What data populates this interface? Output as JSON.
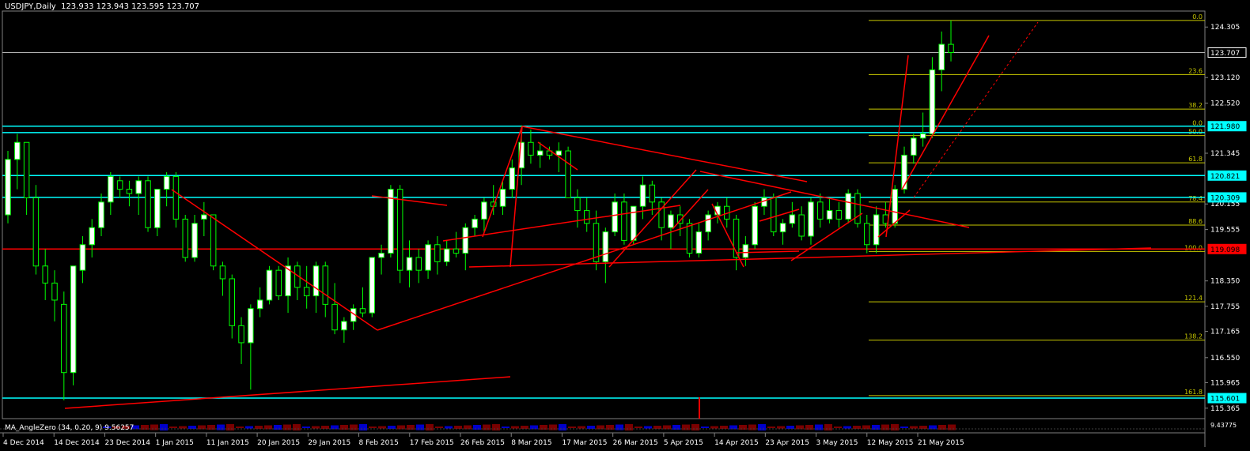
{
  "header": {
    "symbol": "USDJPY,Daily",
    "ohlc": "123.933 123.943 123.595 123.707"
  },
  "subwindow": {
    "label": "MA_AngleZero (34, 0.20, 9) 9.56257",
    "value_label": "9.43775"
  },
  "colors": {
    "background": "#000000",
    "bull": "#ffffff",
    "bear": "#000000",
    "wick": "#00ff00",
    "support": "#00ffff",
    "trend": "#ff0000",
    "fib": "#c8c800",
    "axis_text": "#ffffff"
  },
  "chart_data": {
    "type": "candlestick",
    "x_labels": [
      "4 Dec 2014",
      "14 Dec 2014",
      "23 Dec 2014",
      "1 Jan 2015",
      "11 Jan 2015",
      "20 Jan 2015",
      "29 Jan 2015",
      "8 Feb 2015",
      "17 Feb 2015",
      "26 Feb 2015",
      "8 Mar 2015",
      "17 Mar 2015",
      "26 Mar 2015",
      "5 Apr 2015",
      "14 Apr 2015",
      "23 Apr 2015",
      "3 May 2015",
      "12 May 2015",
      "21 May 2015"
    ],
    "y_ticks": [
      "124.305",
      "123.120",
      "122.520",
      "121.345",
      "120.155",
      "119.555",
      "118.350",
      "117.755",
      "117.165",
      "116.550",
      "115.965",
      "115.365"
    ],
    "y_tick_values": [
      124.305,
      123.12,
      122.52,
      121.345,
      120.155,
      119.555,
      118.35,
      117.755,
      117.165,
      116.55,
      115.965,
      115.365
    ],
    "ylim": [
      115.12,
      124.68
    ],
    "price_labels": [
      {
        "text": "123.707",
        "value": 123.707,
        "style": "last"
      },
      {
        "text": "121.980",
        "value": 121.98,
        "style": "cyan"
      },
      {
        "text": "120.821",
        "value": 120.821,
        "style": "cyan"
      },
      {
        "text": "120.309",
        "value": 120.309,
        "style": "cyan"
      },
      {
        "text": "119.098",
        "value": 119.098,
        "style": "red"
      },
      {
        "text": "115.601",
        "value": 115.601,
        "style": "cyan"
      }
    ],
    "support_levels": [
      121.98,
      121.83,
      120.821,
      120.309,
      115.601
    ],
    "resistance_level": 119.098,
    "last_price": 123.707,
    "fib_levels": [
      {
        "label": "0.0",
        "value": 124.46
      },
      {
        "label": "23.6",
        "value": 123.19
      },
      {
        "label": "38.2",
        "value": 122.38
      },
      {
        "label": "50.0",
        "value": 121.76
      },
      {
        "label": "61.8",
        "value": 121.12
      },
      {
        "label": "78.4",
        "value": 120.2
      },
      {
        "label": "88.6",
        "value": 119.66
      },
      {
        "label": "100.0",
        "value": 119.04
      },
      {
        "label": "121.4",
        "value": 117.86
      },
      {
        "label": "138.2",
        "value": 116.96
      },
      {
        "label": "161.8",
        "value": 115.66
      }
    ],
    "fib_top_label": {
      "label": "0.0",
      "value": 121.98
    },
    "candles": [
      [
        119.9,
        121.4,
        119.7,
        121.2
      ],
      [
        121.2,
        121.8,
        120.5,
        121.6
      ],
      [
        121.6,
        121.6,
        119.9,
        120.3
      ],
      [
        120.3,
        120.6,
        118.5,
        118.7
      ],
      [
        118.7,
        119.1,
        117.9,
        118.3
      ],
      [
        118.3,
        118.6,
        117.4,
        117.9
      ],
      [
        117.8,
        118.1,
        115.55,
        116.2
      ],
      [
        116.2,
        118.7,
        115.9,
        118.7
      ],
      [
        118.6,
        119.4,
        118.3,
        119.2
      ],
      [
        119.2,
        119.8,
        118.9,
        119.6
      ],
      [
        119.6,
        120.4,
        119.4,
        120.2
      ],
      [
        120.2,
        120.9,
        119.9,
        120.8
      ],
      [
        120.7,
        120.8,
        120.3,
        120.5
      ],
      [
        120.5,
        120.7,
        120.1,
        120.4
      ],
      [
        120.4,
        120.8,
        119.9,
        120.7
      ],
      [
        120.7,
        120.8,
        119.5,
        119.6
      ],
      [
        119.6,
        120.5,
        119.4,
        120.5
      ],
      [
        120.5,
        120.9,
        120.1,
        120.8
      ],
      [
        120.8,
        120.9,
        119.6,
        119.8
      ],
      [
        119.8,
        119.9,
        118.8,
        118.9
      ],
      [
        118.9,
        119.9,
        118.8,
        119.7
      ],
      [
        119.8,
        120.2,
        119.4,
        119.9
      ],
      [
        119.9,
        119.9,
        118.6,
        118.7
      ],
      [
        118.7,
        118.8,
        118.0,
        118.4
      ],
      [
        118.4,
        118.5,
        117.0,
        117.3
      ],
      [
        117.3,
        117.5,
        116.4,
        116.9
      ],
      [
        116.9,
        117.8,
        115.8,
        117.7
      ],
      [
        117.7,
        118.2,
        117.5,
        117.9
      ],
      [
        117.9,
        118.7,
        117.8,
        118.6
      ],
      [
        118.6,
        118.7,
        117.9,
        118.0
      ],
      [
        118.0,
        118.9,
        117.6,
        118.7
      ],
      [
        118.7,
        118.8,
        117.9,
        118.2
      ],
      [
        118.2,
        118.7,
        117.7,
        118.0
      ],
      [
        118.0,
        118.8,
        117.6,
        118.7
      ],
      [
        118.7,
        118.8,
        117.5,
        117.8
      ],
      [
        117.8,
        118.3,
        117.1,
        117.2
      ],
      [
        117.2,
        117.5,
        116.9,
        117.4
      ],
      [
        117.4,
        117.8,
        117.2,
        117.7
      ],
      [
        117.7,
        118.2,
        117.5,
        117.6
      ],
      [
        117.6,
        118.9,
        117.5,
        118.9
      ],
      [
        118.9,
        119.2,
        118.5,
        119.0
      ],
      [
        119.0,
        120.6,
        118.9,
        120.5
      ],
      [
        120.5,
        120.6,
        118.3,
        118.6
      ],
      [
        118.6,
        119.3,
        118.2,
        118.9
      ],
      [
        118.9,
        119.1,
        118.3,
        118.6
      ],
      [
        118.6,
        119.3,
        118.4,
        119.2
      ],
      [
        119.2,
        119.4,
        118.5,
        118.8
      ],
      [
        118.8,
        119.3,
        118.7,
        119.1
      ],
      [
        119.1,
        119.5,
        118.9,
        119.0
      ],
      [
        119.0,
        119.7,
        118.6,
        119.6
      ],
      [
        119.6,
        119.9,
        119.4,
        119.8
      ],
      [
        119.8,
        120.3,
        119.5,
        120.2
      ],
      [
        120.2,
        120.6,
        119.9,
        120.1
      ],
      [
        120.1,
        120.7,
        119.9,
        120.5
      ],
      [
        120.5,
        121.2,
        120.3,
        121.0
      ],
      [
        121.0,
        122.0,
        120.6,
        121.6
      ],
      [
        121.6,
        121.9,
        121.1,
        121.3
      ],
      [
        121.3,
        121.6,
        121.0,
        121.4
      ],
      [
        121.4,
        121.5,
        121.2,
        121.3
      ],
      [
        121.3,
        121.6,
        120.9,
        121.4
      ],
      [
        121.4,
        121.5,
        120.3,
        120.3
      ],
      [
        120.3,
        120.5,
        119.6,
        120.0
      ],
      [
        120.0,
        120.3,
        119.5,
        119.7
      ],
      [
        119.7,
        120.0,
        118.6,
        118.8
      ],
      [
        118.8,
        119.6,
        118.3,
        119.5
      ],
      [
        119.5,
        120.4,
        119.4,
        120.2
      ],
      [
        120.2,
        120.4,
        119.2,
        119.3
      ],
      [
        119.3,
        120.1,
        119.2,
        120.1
      ],
      [
        120.1,
        120.8,
        119.8,
        120.6
      ],
      [
        120.6,
        120.7,
        119.9,
        120.2
      ],
      [
        120.2,
        120.3,
        119.3,
        119.6
      ],
      [
        119.6,
        120.0,
        119.1,
        119.9
      ],
      [
        119.9,
        120.1,
        119.4,
        119.7
      ],
      [
        119.7,
        119.8,
        118.9,
        119.0
      ],
      [
        119.0,
        119.7,
        118.9,
        119.5
      ],
      [
        119.5,
        120.0,
        119.3,
        119.9
      ],
      [
        119.9,
        120.2,
        119.7,
        120.1
      ],
      [
        120.1,
        120.3,
        119.6,
        119.8
      ],
      [
        119.8,
        119.9,
        118.6,
        118.9
      ],
      [
        118.9,
        119.4,
        118.7,
        119.2
      ],
      [
        119.2,
        120.2,
        119.1,
        120.1
      ],
      [
        120.1,
        120.5,
        119.9,
        120.3
      ],
      [
        120.3,
        120.4,
        119.4,
        119.5
      ],
      [
        119.5,
        119.8,
        119.2,
        119.7
      ],
      [
        119.7,
        120.2,
        119.6,
        119.9
      ],
      [
        119.9,
        120.1,
        119.3,
        119.4
      ],
      [
        119.4,
        120.3,
        119.2,
        120.2
      ],
      [
        120.2,
        120.4,
        119.6,
        119.8
      ],
      [
        119.8,
        120.3,
        119.7,
        120.0
      ],
      [
        120.0,
        120.2,
        119.6,
        119.8
      ],
      [
        119.8,
        120.5,
        119.7,
        120.4
      ],
      [
        120.4,
        120.5,
        119.6,
        119.7
      ],
      [
        119.7,
        119.9,
        119.0,
        119.2
      ],
      [
        119.2,
        120.1,
        119.0,
        119.9
      ],
      [
        119.9,
        120.2,
        119.6,
        119.7
      ],
      [
        119.7,
        120.6,
        119.6,
        120.5
      ],
      [
        120.5,
        121.5,
        120.4,
        121.3
      ],
      [
        121.3,
        121.8,
        121.1,
        121.7
      ],
      [
        121.7,
        122.3,
        121.5,
        121.8
      ],
      [
        121.8,
        123.6,
        121.7,
        123.3
      ],
      [
        123.3,
        124.2,
        122.8,
        123.9
      ],
      [
        123.9,
        124.46,
        123.5,
        123.707
      ]
    ],
    "trend_lines": [
      [
        [
          82,
          517
        ],
        [
          645,
          477
        ]
      ],
      [
        [
          217,
          240
        ],
        [
          477,
          418
        ]
      ],
      [
        [
          477,
          418
        ],
        [
          1000,
          243
        ]
      ],
      [
        [
          593,
          338
        ],
        [
          1455,
          314
        ]
      ],
      [
        [
          660,
          160
        ],
        [
          1020,
          230
        ]
      ],
      [
        [
          660,
          160
        ],
        [
          610,
          300
        ]
      ],
      [
        [
          660,
          160
        ],
        [
          645,
          338
        ]
      ],
      [
        [
          560,
          305
        ],
        [
          860,
          260
        ]
      ],
      [
        [
          885,
          217
        ],
        [
          1225,
          288
        ]
      ],
      [
        [
          770,
          338
        ],
        [
          880,
          215
        ]
      ],
      [
        [
          900,
          258
        ],
        [
          940,
          338
        ]
      ],
      [
        [
          930,
          320
        ],
        [
          1010,
          318
        ]
      ],
      [
        [
          1000,
          330
        ],
        [
          1090,
          270
        ]
      ],
      [
        [
          1120,
          300
        ],
        [
          1148,
          70
        ]
      ],
      [
        [
          1140,
          240
        ],
        [
          1250,
          45
        ]
      ],
      [
        [
          1110,
          300
        ],
        [
          1150,
          266
        ]
      ],
      [
        [
          470,
          248
        ],
        [
          565,
          260
        ]
      ],
      [
        [
          680,
          180
        ],
        [
          730,
          215
        ]
      ],
      [
        [
          960,
          280
        ],
        [
          1010,
          265
        ]
      ],
      [
        [
          850,
          290
        ],
        [
          895,
          240
        ]
      ]
    ],
    "dashed_trend": [
      [
        1155,
        250
      ],
      [
        1312,
        28
      ]
    ],
    "spike_x": 884,
    "indicator": {
      "name": "MA_AngleZero",
      "params": "34, 0.20, 9",
      "value": 9.56257
    }
  }
}
